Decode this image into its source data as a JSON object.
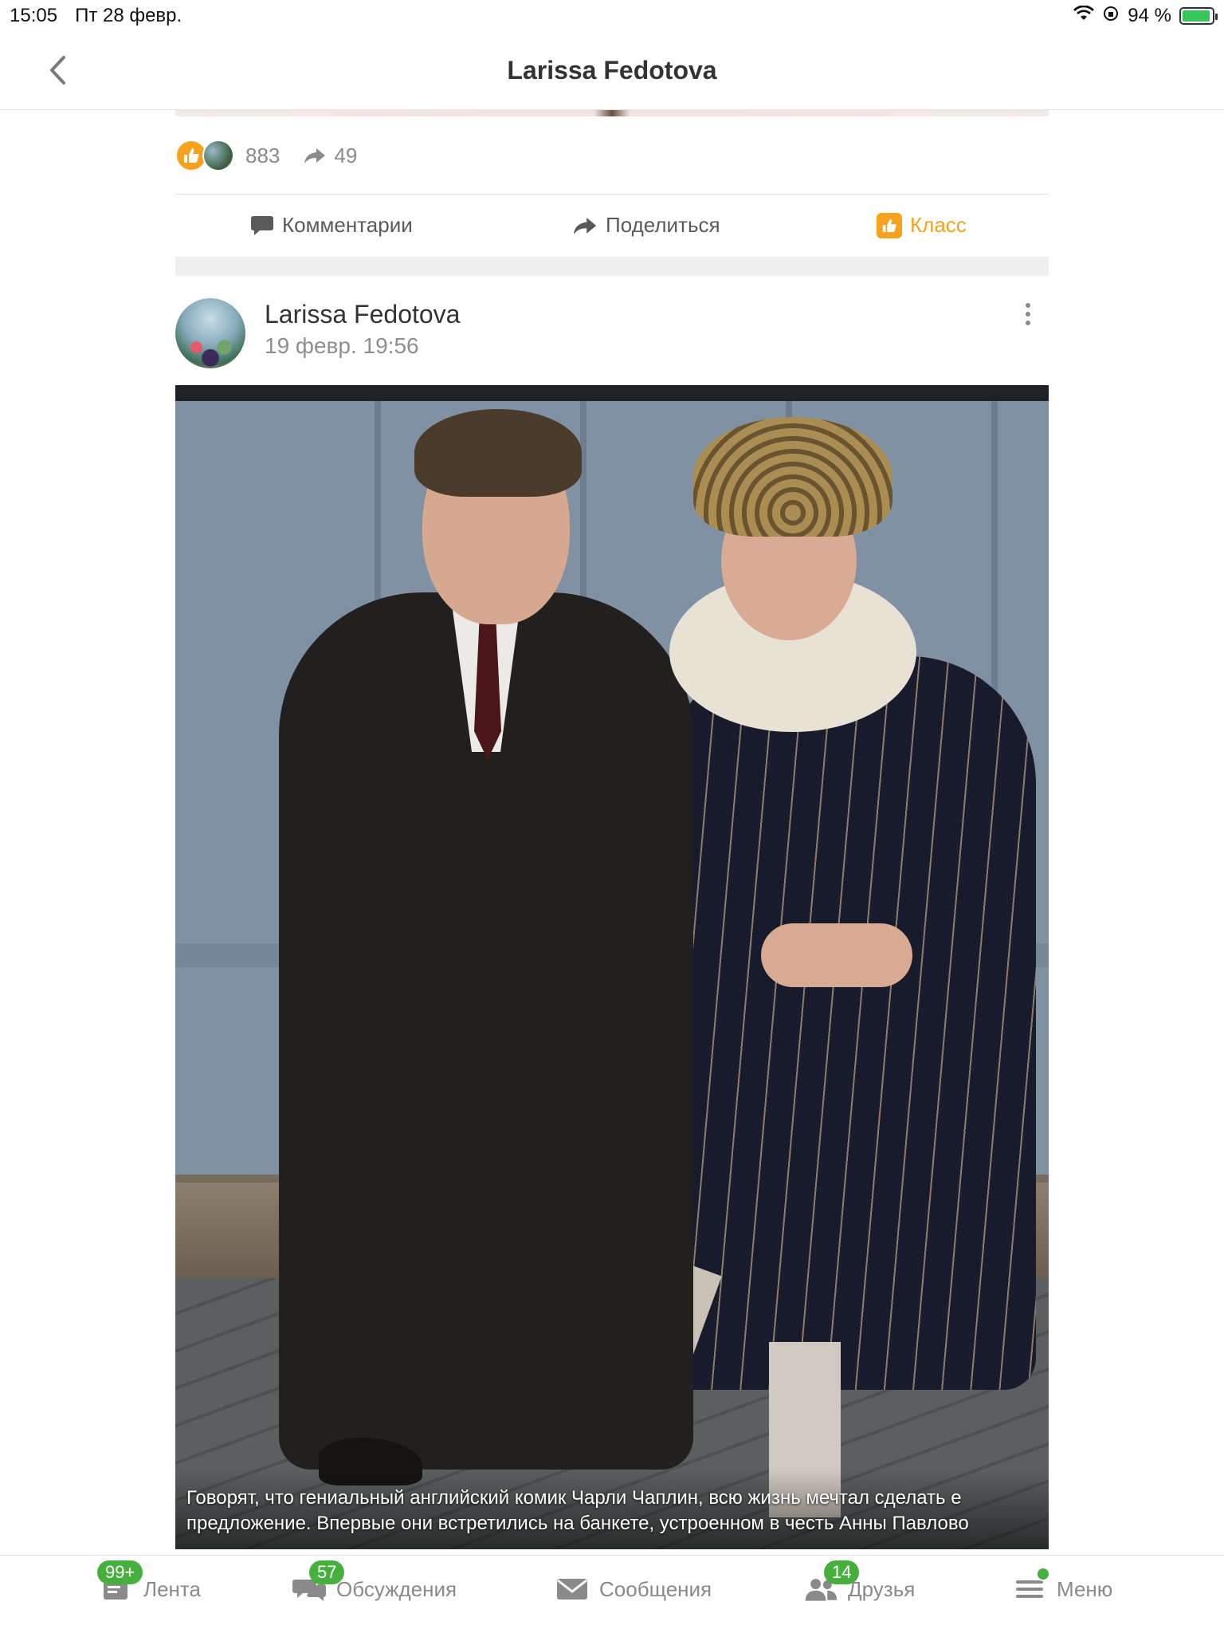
{
  "status_bar": {
    "time": "15:05",
    "date": "Пт 28 февр.",
    "battery": "94 %"
  },
  "header": {
    "title": "Larissa Fedotova"
  },
  "previous_post": {
    "reactions_count": "883",
    "shares_count": "49",
    "actions": {
      "comments": "Комментарии",
      "share": "Поделиться",
      "klass": "Класс"
    }
  },
  "post": {
    "author": "Larissa Fedotova",
    "time": "19 февр. 19:56",
    "caption_line1": "Говорят, что гениальный английский комик Чарли Чаплин, всю жизнь мечтал сделать е",
    "caption_line2": "предложение. Впервые они встретились на банкете, устроенном в честь Анны Павлово"
  },
  "bottom_nav": {
    "items": [
      {
        "label": "Лента",
        "badge": "99+"
      },
      {
        "label": "Обсуждения",
        "badge": "57"
      },
      {
        "label": "Сообщения",
        "badge": ""
      },
      {
        "label": "Друзья",
        "badge": "14"
      },
      {
        "label": "Меню",
        "badge": ""
      }
    ]
  },
  "colors": {
    "accent_orange": "#f7a21c",
    "badge_green": "#46b03e"
  }
}
